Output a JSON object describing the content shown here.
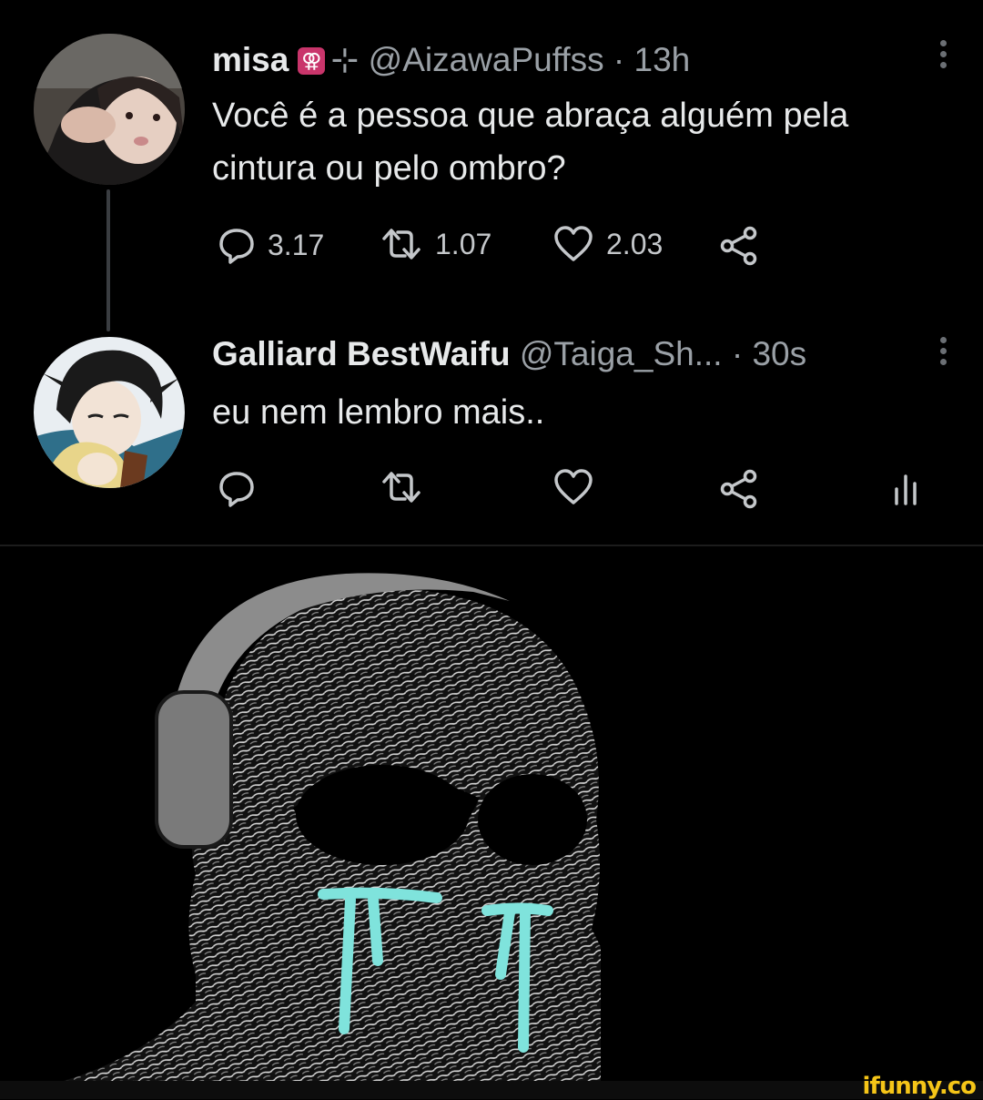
{
  "tweet1": {
    "name": "misa",
    "badge_icon": "female-pride-icon",
    "sparkle": "⊹",
    "handle": "@AizawaPuffss",
    "time": "· 13h",
    "text_line1": "Você é a pessoa que abraça alguém pela",
    "text_line2": "cintura ou pelo ombro?",
    "replies": "3.17",
    "retweets": "1.07",
    "likes": "2.03"
  },
  "tweet2": {
    "name": "Galliard BestWaifu",
    "handle": "@Taiga_Sh...",
    "time": "· 30s",
    "text": "eu nem lembro mais.."
  },
  "watermark": "ifunny.co",
  "colors": {
    "background": "#000000",
    "text": "#e7e9ea",
    "muted": "#9aa0a6",
    "tears": "#7fe3dc",
    "watermark": "#f5c518"
  }
}
